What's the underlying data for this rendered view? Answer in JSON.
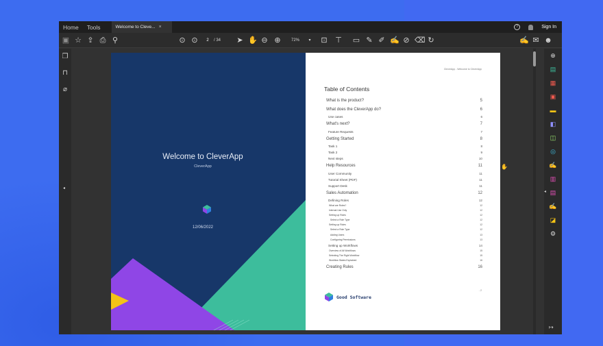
{
  "tabs": {
    "home": "Home",
    "tools": "Tools",
    "document_tab": "Welcome to Cleve...",
    "close_symbol": "×",
    "sign_in": "Sign In"
  },
  "toolbar": {
    "page_current": "2",
    "page_total": "/ 34",
    "zoom": "72%"
  },
  "cover": {
    "title": "Welcome to CleverApp",
    "subtitle": "CleverApp",
    "date": "12/06/2022"
  },
  "toc_page": {
    "header": "CleverApp - Welcome to CleverApp",
    "heading": "Table of Contents",
    "entries": [
      {
        "level": 1,
        "title": "What is the product?",
        "page": "5"
      },
      {
        "level": 1,
        "title": "What does the CleverApp do?",
        "page": "6"
      },
      {
        "level": 2,
        "title": "Use cases",
        "page": "6"
      },
      {
        "level": 1,
        "title": "What's next?",
        "page": "7"
      },
      {
        "level": 2,
        "title": "Feature Requests",
        "page": "7"
      },
      {
        "level": 1,
        "title": "Getting Started",
        "page": "8"
      },
      {
        "level": 2,
        "title": "Task 1",
        "page": "8"
      },
      {
        "level": 2,
        "title": "Task 2",
        "page": "9"
      },
      {
        "level": 2,
        "title": "Next steps",
        "page": "10"
      },
      {
        "level": 1,
        "title": "Help Resources",
        "page": "11"
      },
      {
        "level": 2,
        "title": "User Community",
        "page": "11"
      },
      {
        "level": 2,
        "title": "Tutorial Sheet (PDF)",
        "page": "11"
      },
      {
        "level": 2,
        "title": "Support Desk",
        "page": "11"
      },
      {
        "level": 1,
        "title": "Sales Automation",
        "page": "12"
      },
      {
        "level": 2,
        "title": "Defining Roles",
        "page": "12"
      },
      {
        "level": 3,
        "title": "What are Roles?",
        "page": "12"
      },
      {
        "level": 3,
        "title": "Internal Use Only",
        "page": "12"
      },
      {
        "level": 3,
        "title": "Setting up Roles",
        "page": "12"
      },
      {
        "level": 4,
        "title": "Select a Role Type",
        "page": "12"
      },
      {
        "level": 3,
        "title": "Setting up Roles",
        "page": "12"
      },
      {
        "level": 4,
        "title": "Select a Role Type",
        "page": "12"
      },
      {
        "level": 4,
        "title": "Adding Users",
        "page": "13"
      },
      {
        "level": 4,
        "title": "Configuring Permissions",
        "page": "13"
      },
      {
        "level": 2,
        "title": "Setting up Workflows",
        "page": "14"
      },
      {
        "level": 3,
        "title": "Overview of All Workflows",
        "page": "15"
      },
      {
        "level": 3,
        "title": "Selecting The Right Workflow",
        "page": "15"
      },
      {
        "level": 3,
        "title": "Workflow States Explained",
        "page": "16"
      },
      {
        "level": 1,
        "title": "Creating Rules",
        "page": "16"
      }
    ],
    "brand": "Good Software",
    "page_marker": "- 2"
  },
  "colors": {
    "cover_bg": "#173769",
    "teal": "#3dbd9c",
    "purple": "#8f46e6",
    "yellow": "#f4c315",
    "accent_blue": "#3b8dff"
  }
}
